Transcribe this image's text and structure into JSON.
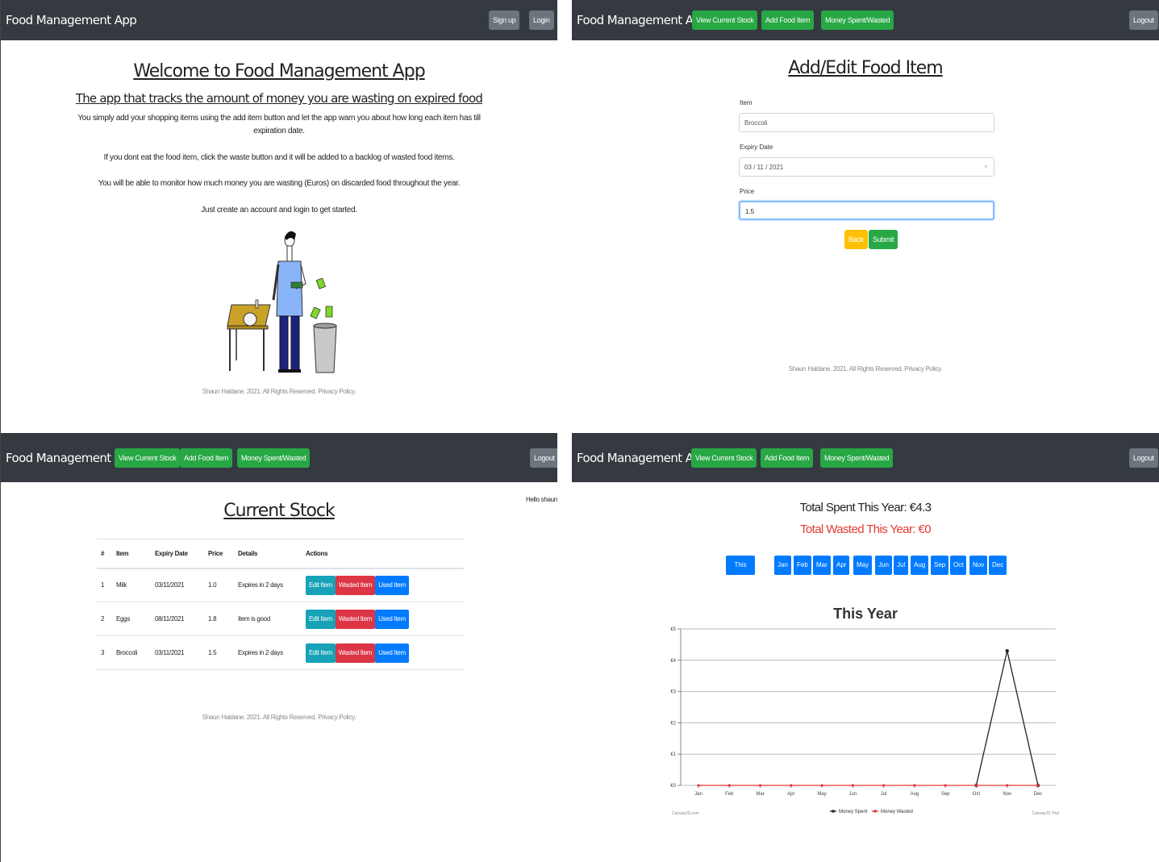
{
  "app": {
    "brand": "Food Management App"
  },
  "nav": {
    "signup": "Sign up",
    "login": "Login",
    "view_stock": "View Current Stock",
    "add_food": "Add Food Item",
    "money": "Money Spent/Wasted",
    "logout": "Logout"
  },
  "welcome": {
    "title": "Welcome to Food Management App",
    "subtitle": "The app that tracks the amount of money you are wasting on expired food",
    "p1a": "You simply add your shopping items using the add item button and let the app warn you about how long each item has till",
    "p1b": "expiration date.",
    "p2": "If you dont eat the food item, click the waste button and it will be added to a backlog of wasted food items.",
    "p3": "You will be able to monitor how much money you are wasting (Euros) on discarded food throughout the year.",
    "p4": "Just create an account and login to get started."
  },
  "footer": "Shaun Haldane. 2021. All Rights Reserved. Privacy Policy.",
  "form": {
    "title": "Add/Edit Food Item",
    "item_label": "Item",
    "item_value": "Broccoli",
    "date_label": "Expiry Date",
    "date_value": "03 / 11 / 2021",
    "price_label": "Price",
    "price_value": "1.5",
    "back": "Back",
    "submit": "Submit"
  },
  "stock": {
    "greeting": "Hello shaun",
    "title": "Current Stock",
    "headers": [
      "#",
      "Item",
      "Expiry Date",
      "Price",
      "Details",
      "Actions"
    ],
    "rows": [
      {
        "n": "1",
        "item": "Milk",
        "date": "03/11/2021",
        "price": "1.0",
        "details": "Expires in 2 days"
      },
      {
        "n": "2",
        "item": "Eggs",
        "date": "08/11/2021",
        "price": "1.8",
        "details": "Item is good"
      },
      {
        "n": "3",
        "item": "Broccoli",
        "date": "03/11/2021",
        "price": "1.5",
        "details": "Expires in 2 days"
      }
    ],
    "edit": "Edit Item",
    "wasted": "Wasted Item",
    "used": "Used Item"
  },
  "money": {
    "total_spent": "Total Spent This Year: €4.3",
    "total_wasted": "Total Wasted This Year: €0",
    "this_year_btn": "This Year",
    "months": [
      "Jan",
      "Feb",
      "Mar",
      "Apr",
      "May",
      "Jun",
      "Jul",
      "Aug",
      "Sep",
      "Oct",
      "Nov",
      "Dec"
    ],
    "credit_left": "CanvasJS.com",
    "credit_right": "CanvasJS Trial",
    "colors": {
      "spent": "#222222",
      "wasted": "#e53935"
    }
  },
  "chart_data": {
    "type": "line",
    "title": "This Year",
    "categories": [
      "Jan",
      "Feb",
      "Mar",
      "Apr",
      "May",
      "Jun",
      "Jul",
      "Aug",
      "Sep",
      "Oct",
      "Nov",
      "Dec"
    ],
    "yticks": [
      "€0",
      "€1",
      "€2",
      "€3",
      "€4",
      "€5"
    ],
    "ylim": [
      0,
      5
    ],
    "grid": true,
    "legend_position": "bottom",
    "series": [
      {
        "name": "Money Spent",
        "values": [
          null,
          null,
          null,
          null,
          null,
          null,
          null,
          null,
          null,
          0,
          4.3,
          0
        ]
      },
      {
        "name": "Money Wasted",
        "values": [
          0,
          0,
          0,
          0,
          0,
          0,
          0,
          0,
          0,
          0,
          0,
          0
        ]
      }
    ]
  }
}
